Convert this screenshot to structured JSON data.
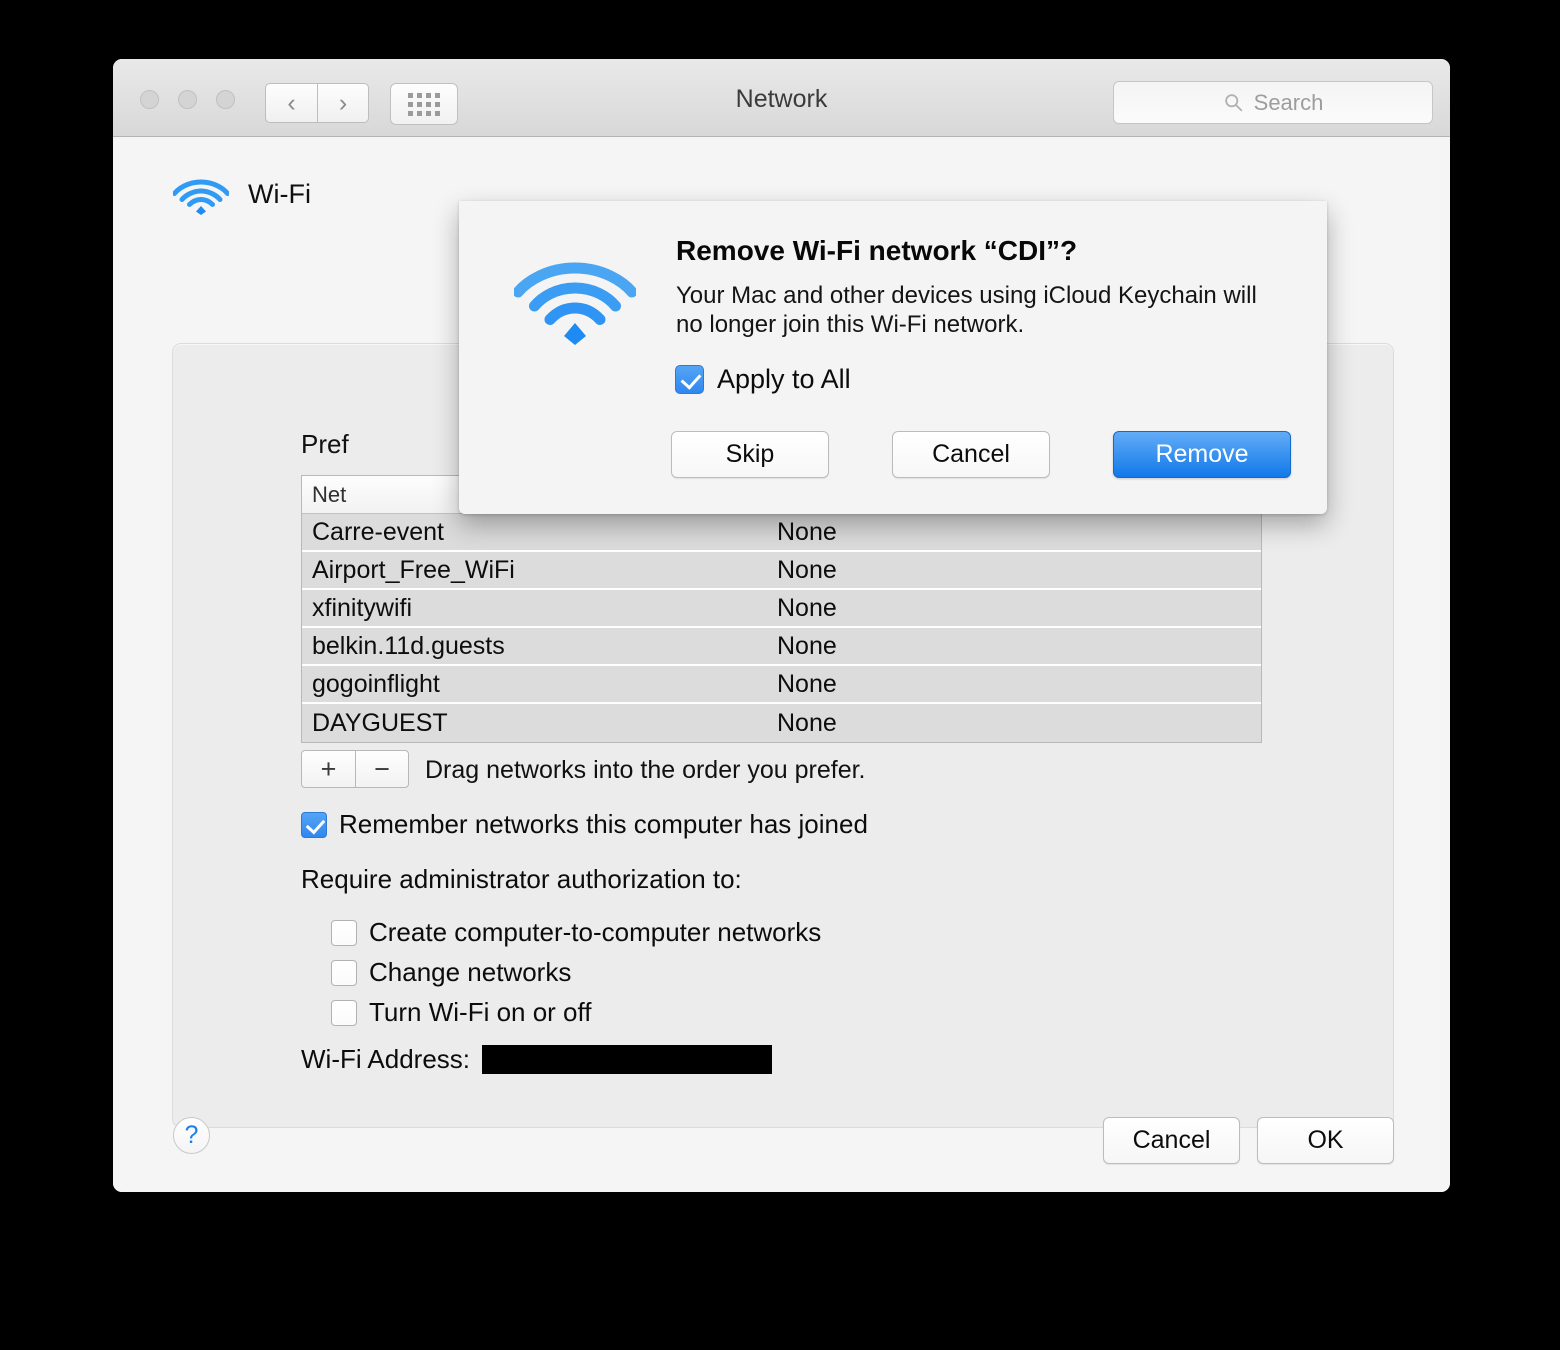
{
  "window": {
    "title": "Network",
    "traffic_lights": [
      "close",
      "minimize",
      "zoom"
    ],
    "nav": {
      "back": "‹",
      "forward": "›"
    },
    "grid_button": "show-all-grid",
    "search": {
      "placeholder": "Search",
      "value": ""
    }
  },
  "content": {
    "service": {
      "name": "Wi-Fi"
    },
    "preferred_label": "Pref",
    "table": {
      "headers": [
        "Net",
        ""
      ],
      "rows": [
        {
          "name": "Carre-event",
          "security": "None"
        },
        {
          "name": "Airport_Free_WiFi",
          "security": "None"
        },
        {
          "name": "xfinitywifi",
          "security": "None"
        },
        {
          "name": "belkin.11d.guests",
          "security": "None"
        },
        {
          "name": "gogoinflight",
          "security": "None"
        },
        {
          "name": "DAYGUEST",
          "security": "None"
        }
      ]
    },
    "add_button": "+",
    "remove_button": "−",
    "drag_hint": "Drag networks into the order you prefer.",
    "remember_networks": {
      "label": "Remember networks this computer has joined",
      "checked": true
    },
    "require_admin_label": "Require administrator authorization to:",
    "admin_options": [
      {
        "label": "Create computer-to-computer networks",
        "checked": false
      },
      {
        "label": "Change networks",
        "checked": false
      },
      {
        "label": "Turn Wi-Fi on or off",
        "checked": false
      }
    ],
    "wifi_address": {
      "label": "Wi-Fi Address:",
      "value": ""
    },
    "help_button": "?",
    "cancel_button": "Cancel",
    "ok_button": "OK"
  },
  "dialog": {
    "icon": "wifi-icon",
    "title": "Remove Wi-Fi network “CDI”?",
    "message": "Your Mac and other devices using iCloud Keychain will no longer join this Wi-Fi network.",
    "apply_to_all": {
      "label": "Apply to All",
      "checked": true
    },
    "skip_button": "Skip",
    "cancel_button": "Cancel",
    "remove_button": "Remove"
  },
  "colors": {
    "accent_blue": "#2f87ef",
    "primary_button_top": "#62acf7",
    "primary_button_bottom": "#1179e9",
    "wifi_icon_blue": "#2f9bf5",
    "window_bg": "#ececec",
    "content_bg": "#f5f5f5",
    "row_bg": "#dcdcdc"
  }
}
